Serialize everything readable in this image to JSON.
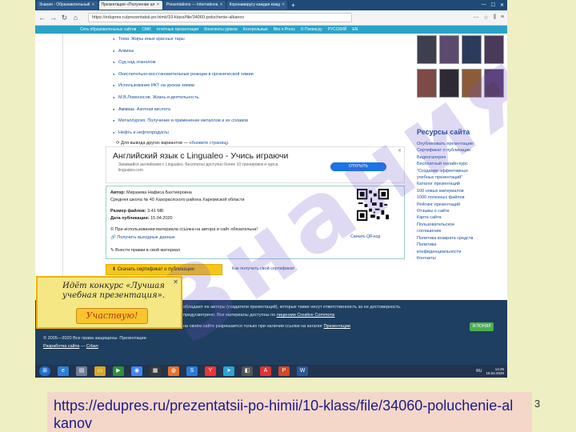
{
  "browser": {
    "tabs": [
      {
        "label": "Знания - Образовательный",
        "active": false
      },
      {
        "label": "Презентация «Получение ал",
        "active": true
      },
      {
        "label": "Presentations — Internationa",
        "active": false
      },
      {
        "label": "Коронавирусу каждая кажд",
        "active": false
      }
    ],
    "new_tab_label": "+",
    "url": "https://edupres.ru/prezentatsii-po-himii/10-klass/file/34060-poluchenie-alkanov"
  },
  "site_nav": {
    "items": [
      "Сеть образовательных сайтов",
      "СМИ",
      "отчётные презентации",
      "Конспекты уроков",
      "Контрольные",
      "Bite o Press",
      "О Пюпик.ру",
      "РУССКИЙ",
      "EN"
    ]
  },
  "main": {
    "links": [
      "Тема: Жиры иные красные тары",
      "Алкины",
      "Суд над этанолом",
      "Окислительно-восстановительные реакции в органической химии",
      "Использование ИКТ на уроках химии",
      "М.В.Ломоносов. Жизнь и деятельность.",
      "Аммиак. Азотная кислота",
      "Металлургия. Получение и применение металлов и их сплавов",
      "Нефть и нефтепродукты"
    ],
    "variants_text": "Для вывода других вариантов —",
    "variants_link": "обновите страницу."
  },
  "ad": {
    "title": "Английский язык с Lingualeo - Учись играючи",
    "description": "Занимайся английским с Lingualeo. Бесплатно доступно более 10 тренировок и курса lingualeo.com",
    "button": "ОТКРЫТЬ",
    "close": "✕"
  },
  "file_info": {
    "author_label": "Автор:",
    "author": "Мирзаева Нафиса Бахтиёровна",
    "school": "Средняя школа № 40 Хазораспского района Харезмской области",
    "size_label": "Размер файлов:",
    "size": "3.41 МБ",
    "date_label": "Дата публикации:",
    "date": "15.04.2020",
    "notice": "При использовании материала ссылка на автора и сайт обязательна!",
    "output_data": "Получить выходные данные",
    "edit": "Внести правки в свой материал",
    "qr_caption": "Скачать QR-код"
  },
  "cert": {
    "button": "Скачать сертификат о публикации",
    "link": "Как получить свой сертификат"
  },
  "resources": {
    "title": "Ресурсы сайта",
    "items": [
      "Опубликовать презентацию",
      "Сертификат о публикации",
      "Видеогалерея",
      "Бесплатный онлайн-курс",
      "\"Создание эффективных",
      "учебных презентаций\"",
      "Каталог презентаций",
      "100 новых материалов",
      "1000 полезных файлов",
      "Рейтинг презентаций",
      "Отзывы о сайте",
      "Карта сайта",
      "Пользовательское",
      "соглашение",
      "Политика возврата средств",
      "Политика",
      "конфиденциальности",
      "Контакты"
    ]
  },
  "footer": {
    "line1": "обладают ее авторы (создатели презентаций), которые также несут ответственность за ее достоверность.",
    "line2": "предусмотрено. Все материалы доступны по",
    "license_link": "лицензии Creative Commons",
    "line3": "на своём сайте разрешается только при наличии ссылки на каталог",
    "presentations_link": "Презентации",
    "copyright": "© 2005—2020 Все права защищены. Презентации",
    "dev": "Разработка сайта",
    "dev_link": "Crban",
    "agree": "Я ПОНЯЛ"
  },
  "contest": {
    "text": "Идёт конкурс «Лучшая учебная презентация».",
    "button": "Участвую!",
    "close": "✕"
  },
  "taskbar": {
    "lang": "RU",
    "time": "14:25",
    "date": "15.04.2020"
  },
  "watermark": "Знания",
  "slide_number": "3",
  "caption": "https://edupres.ru/prezentatsii-po-himii/10-klass/file/34060-poluchenie-alkanov",
  "colors": {
    "slide_bg": "#eef0c4",
    "caption_bg": "#f4d7c9",
    "caption_text": "#1a1a8c",
    "site_nav": "#2aa3c7",
    "footer": "#1e3f5f",
    "contest_bg": "#f5e784"
  }
}
